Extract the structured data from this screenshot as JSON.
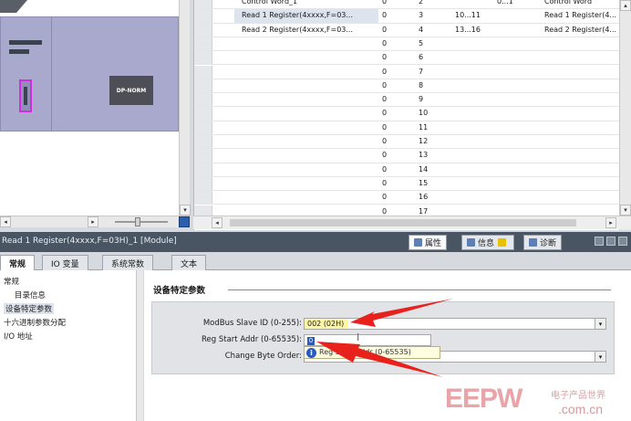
{
  "device_view": {
    "module_label": "DP-NORM",
    "corner_tag": "",
    "scroll_left": "◂",
    "scroll_right": "▸",
    "scroll_down": "▾"
  },
  "overview_table": {
    "rows": [
      {
        "name": "Control Word_1",
        "rack": "0",
        "slot": "2",
        "iaddr": "",
        "qaddr": "0...1",
        "type": "Control Word"
      },
      {
        "name": "Read 1 Register(4xxxx,F=03...",
        "rack": "0",
        "slot": "3",
        "iaddr": "10...11",
        "qaddr": "",
        "type": "Read 1 Register(4..."
      },
      {
        "name": "Read 2 Register(4xxxx,F=03...",
        "rack": "0",
        "slot": "4",
        "iaddr": "13...16",
        "qaddr": "",
        "type": "Read 2 Register(4..."
      },
      {
        "name": "",
        "rack": "0",
        "slot": "5",
        "iaddr": "",
        "qaddr": "",
        "type": ""
      },
      {
        "name": "",
        "rack": "0",
        "slot": "6",
        "iaddr": "",
        "qaddr": "",
        "type": ""
      },
      {
        "name": "",
        "rack": "0",
        "slot": "7",
        "iaddr": "",
        "qaddr": "",
        "type": ""
      },
      {
        "name": "",
        "rack": "0",
        "slot": "8",
        "iaddr": "",
        "qaddr": "",
        "type": ""
      },
      {
        "name": "",
        "rack": "0",
        "slot": "9",
        "iaddr": "",
        "qaddr": "",
        "type": ""
      },
      {
        "name": "",
        "rack": "0",
        "slot": "10",
        "iaddr": "",
        "qaddr": "",
        "type": ""
      },
      {
        "name": "",
        "rack": "0",
        "slot": "11",
        "iaddr": "",
        "qaddr": "",
        "type": ""
      },
      {
        "name": "",
        "rack": "0",
        "slot": "12",
        "iaddr": "",
        "qaddr": "",
        "type": ""
      },
      {
        "name": "",
        "rack": "0",
        "slot": "13",
        "iaddr": "",
        "qaddr": "",
        "type": ""
      },
      {
        "name": "",
        "rack": "0",
        "slot": "14",
        "iaddr": "",
        "qaddr": "",
        "type": ""
      },
      {
        "name": "",
        "rack": "0",
        "slot": "15",
        "iaddr": "",
        "qaddr": "",
        "type": ""
      },
      {
        "name": "",
        "rack": "0",
        "slot": "16",
        "iaddr": "",
        "qaddr": "",
        "type": ""
      },
      {
        "name": "",
        "rack": "0",
        "slot": "17",
        "iaddr": "",
        "qaddr": "",
        "type": ""
      }
    ]
  },
  "inspector": {
    "title": "Read 1 Register(4xxxx,F=03H)_1 [Module]",
    "tabs": {
      "properties": "属性",
      "info": "信息",
      "diagnostics": "诊断"
    },
    "prop_tabs": [
      "常规",
      "IO 变量",
      "系统常数",
      "文本"
    ],
    "nav": {
      "general": "常规",
      "catalog": "目录信息",
      "device_params": "设备特定参数",
      "hex_params": "十六进制参数分配",
      "io_addr": "I/O 地址"
    },
    "section_title": "设备特定参数",
    "params": {
      "slave_id_label": "ModBus Slave ID (0-255):",
      "slave_id_value": "002 (02H)",
      "start_addr_label": "Reg Start Addr (0-65535):",
      "start_addr_value": "0",
      "byte_order_label": "Change Byte Order:",
      "tooltip_text": "Reg Start Addr (0-65535)"
    }
  },
  "watermark": {
    "brand": "EEPW",
    "cn_text": "电子产品世界",
    "url": ".com.cn"
  },
  "colors": {
    "accent_arrow": "#e8211d",
    "title_bar": "#4a5563",
    "rack": "#a9a9cd",
    "port_highlight": "#d22be0"
  }
}
